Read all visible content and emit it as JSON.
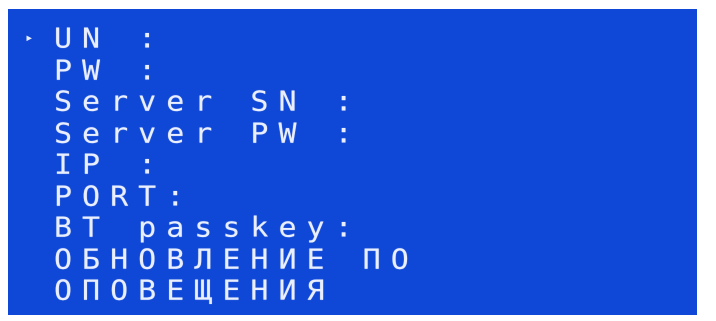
{
  "colors": {
    "screen_background": "#0f47d6",
    "text": "#e9efff",
    "frame": "#ffffff"
  },
  "cursor": {
    "glyph": "▸",
    "selected_index": 0
  },
  "menu": {
    "items": [
      {
        "label": "UN :"
      },
      {
        "label": "PW :"
      },
      {
        "label": "Server SN :"
      },
      {
        "label": "Server PW :"
      },
      {
        "label": "IP :"
      },
      {
        "label": "PORT:"
      },
      {
        "label": "BT passkey:"
      },
      {
        "label": "ОБНОВЛЕНИЕ ПО"
      },
      {
        "label": "ОПОВЕЩЕНИЯ"
      }
    ]
  }
}
